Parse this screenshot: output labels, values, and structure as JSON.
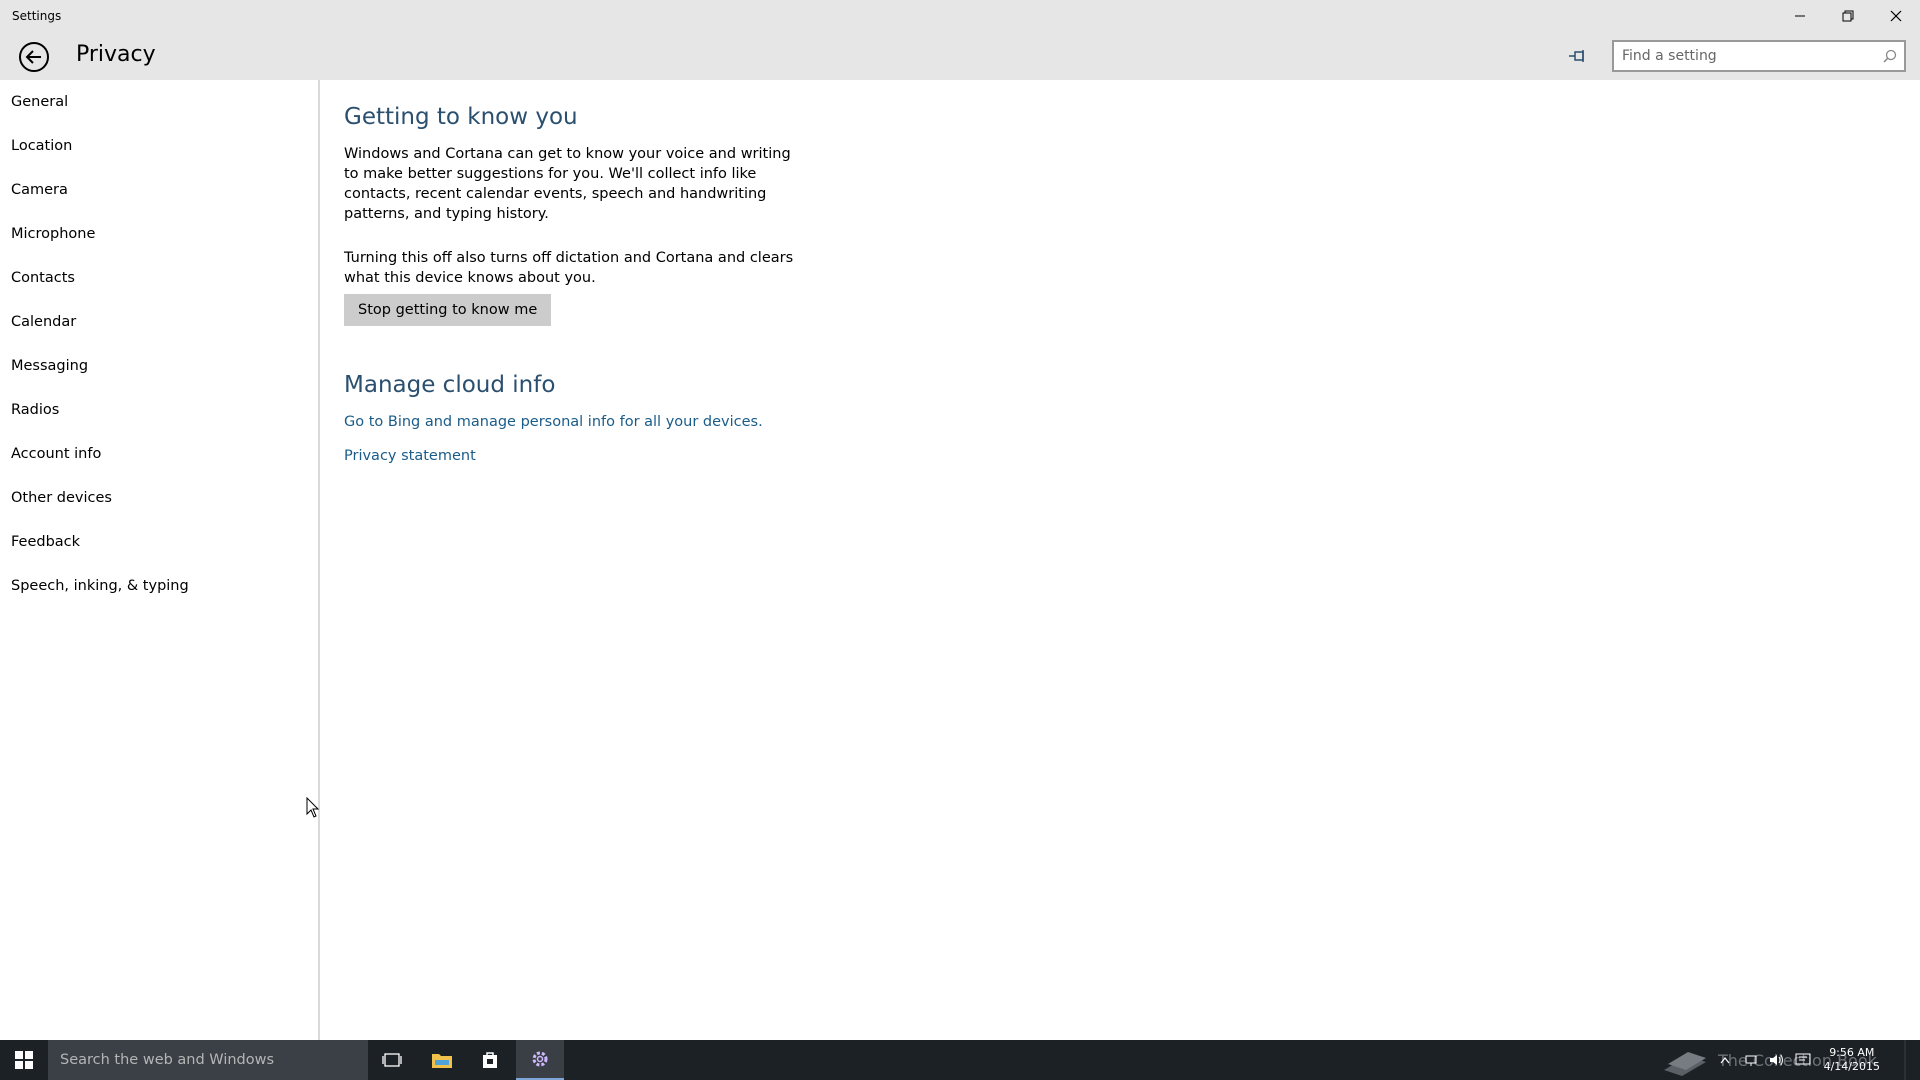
{
  "window": {
    "title": "Settings"
  },
  "header": {
    "title": "Privacy",
    "search_placeholder": "Find a setting"
  },
  "sidebar": {
    "items": [
      {
        "label": "General"
      },
      {
        "label": "Location"
      },
      {
        "label": "Camera"
      },
      {
        "label": "Microphone"
      },
      {
        "label": "Contacts"
      },
      {
        "label": "Calendar"
      },
      {
        "label": "Messaging"
      },
      {
        "label": "Radios"
      },
      {
        "label": "Account info"
      },
      {
        "label": "Other devices"
      },
      {
        "label": "Feedback"
      },
      {
        "label": "Speech, inking, & typing"
      }
    ]
  },
  "main": {
    "section1_title": "Getting to know you",
    "para1": "Windows and Cortana can get to know your voice and writing to make better suggestions for you. We'll collect info like contacts, recent calendar events, speech and handwriting patterns, and typing history.",
    "para2": "Turning this off also turns off dictation and Cortana and clears what this device knows about you.",
    "button_label": "Stop getting to know me",
    "section2_title": "Manage cloud info",
    "link1": "Go to Bing and manage personal info for all your devices.",
    "link2": "Privacy statement"
  },
  "taskbar": {
    "search_placeholder": "Search the web and Windows",
    "watermark": "The Collection Book",
    "time": "9:56 AM",
    "date": "4/14/2015"
  },
  "colors": {
    "accent": "#2b4f6e",
    "link": "#1a5c8a",
    "chrome": "#e6e6e6",
    "taskbar": "#1c2126"
  }
}
